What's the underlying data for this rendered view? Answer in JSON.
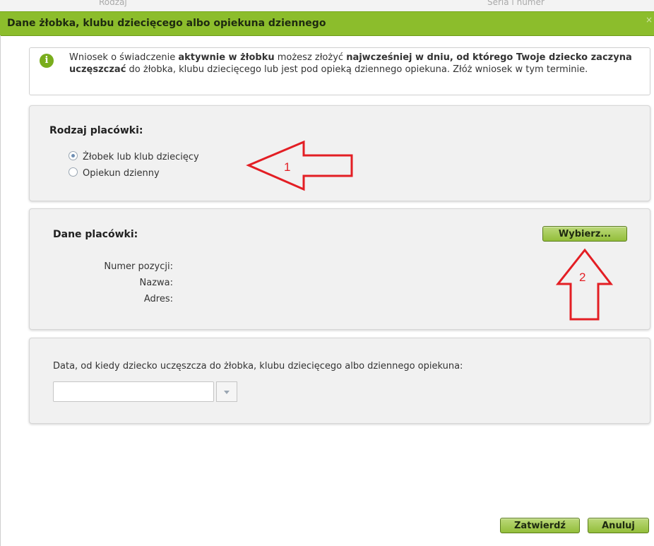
{
  "background": {
    "tab1": "Rodzaj",
    "tab2": "Seria i numer"
  },
  "dialog": {
    "title": "Dane żłobka, klubu dziecięcego albo opiekuna dziennego",
    "close_icon": "×"
  },
  "info": {
    "icon": "i",
    "segments": [
      "Wniosek o świadczenie ",
      "aktywnie w żłobku",
      " możesz złożyć ",
      "najwcześniej w dniu, od którego Twoje dziecko zaczyna uczęszczać",
      " do żłobka, klubu dziecięcego lub jest pod opieką dziennego opiekuna. Złóż wniosek w tym terminie."
    ]
  },
  "rodzaj": {
    "label": "Rodzaj placówki:",
    "options": [
      {
        "label": "Żłobek lub klub dziecięcy",
        "checked": true
      },
      {
        "label": "Opiekun dzienny",
        "checked": false
      }
    ]
  },
  "dane": {
    "label": "Dane placówki:",
    "select_button": "Wybierz...",
    "fields": {
      "numer": "Numer pozycji:",
      "nazwa": "Nazwa:",
      "adres": "Adres:"
    }
  },
  "data_section": {
    "label": "Data, od kiedy dziecko uczęszcza do żłobka, klubu dziecięcego albo dziennego opiekuna:",
    "value": ""
  },
  "footer": {
    "confirm": "Zatwierdź",
    "cancel": "Anuluj"
  },
  "annotations": {
    "arrow1": "1",
    "arrow2": "2"
  },
  "colors": {
    "titlebar": "#8cbd2c",
    "button": "#a5cb52",
    "annotation": "#e31e24"
  }
}
